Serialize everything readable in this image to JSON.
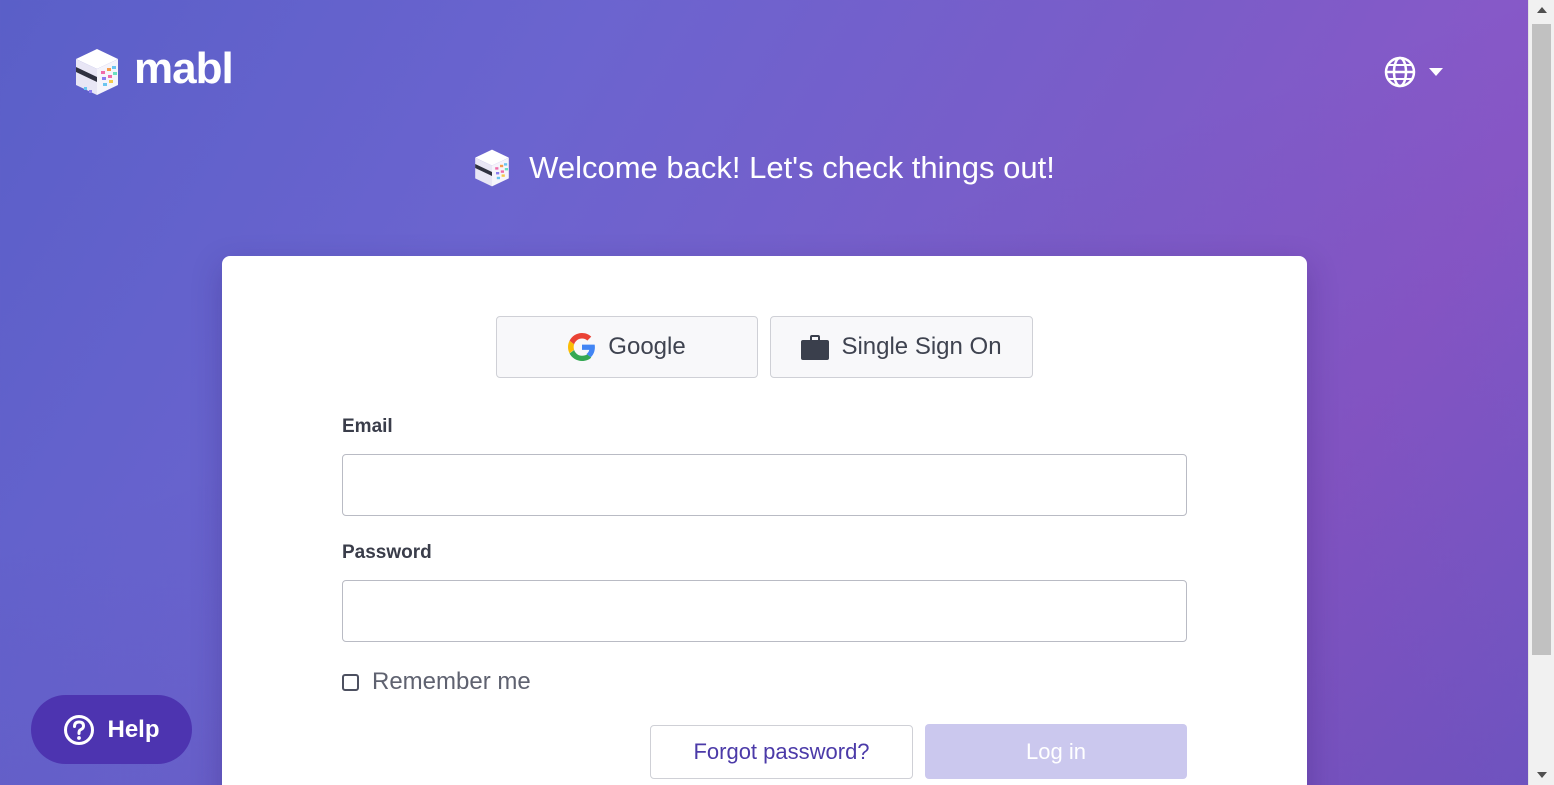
{
  "brand": {
    "name": "mabl",
    "logo_icon": "mabl-cube-icon"
  },
  "language": {
    "icon": "globe-icon",
    "caret": "caret-down-icon"
  },
  "welcome": {
    "text": "Welcome back! Let's check things out!",
    "icon": "mabl-cube-icon"
  },
  "sso": {
    "google_label": "Google",
    "google_icon": "google-g-icon",
    "sso_label": "Single Sign On",
    "sso_icon": "briefcase-icon"
  },
  "form": {
    "email_label": "Email",
    "email_value": "",
    "password_label": "Password",
    "password_value": "",
    "remember_label": "Remember me",
    "remember_checked": false,
    "forgot_label": "Forgot password?",
    "login_label": "Log in"
  },
  "help": {
    "label": "Help",
    "icon": "question-circle-icon"
  },
  "colors": {
    "background_start": "#5a5fc8",
    "background_end": "#8a58c8",
    "accent": "#4d34b0",
    "login_disabled": "#cbc8ee",
    "link_text": "#4b3aa8"
  }
}
